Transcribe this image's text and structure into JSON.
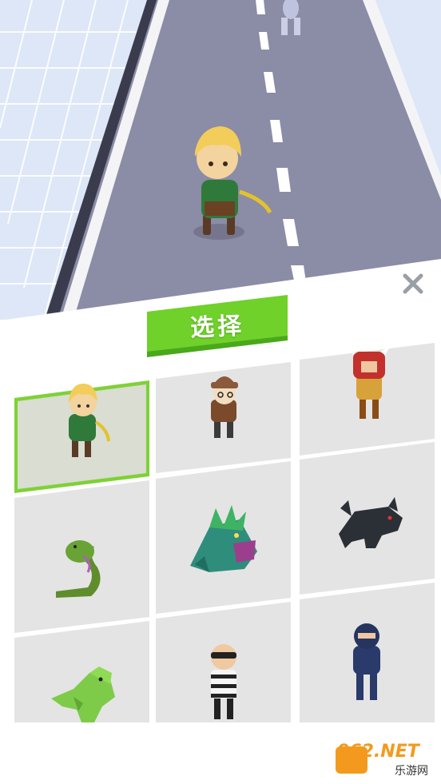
{
  "colors": {
    "road": "#8b8ca6",
    "grass": "#e6eef9",
    "accent_green": "#6fd12a",
    "card_bg": "#e4e4e4",
    "selected_card_bg": "#d9ddd2",
    "panel_bg": "#ffffff"
  },
  "select_button": {
    "label": "选择"
  },
  "close_button": {
    "icon": "close-icon"
  },
  "characters": [
    {
      "name": "elf-archer",
      "icon": "elf-archer-icon",
      "selected": true
    },
    {
      "name": "hat-girl",
      "icon": "hat-girl-icon",
      "selected": false
    },
    {
      "name": "knight",
      "icon": "knight-icon",
      "selected": false
    },
    {
      "name": "snake",
      "icon": "snake-icon",
      "selected": false
    },
    {
      "name": "dinosaur-monster",
      "icon": "spiky-monster-icon",
      "selected": false
    },
    {
      "name": "wolf",
      "icon": "wolf-icon",
      "selected": false
    },
    {
      "name": "green-dinosaur",
      "icon": "dinosaur-icon",
      "selected": false
    },
    {
      "name": "thief",
      "icon": "thief-icon",
      "selected": false
    },
    {
      "name": "ninja",
      "icon": "ninja-icon",
      "selected": false
    }
  ],
  "watermark": {
    "text": "962.NET",
    "subtext": "乐游网"
  }
}
